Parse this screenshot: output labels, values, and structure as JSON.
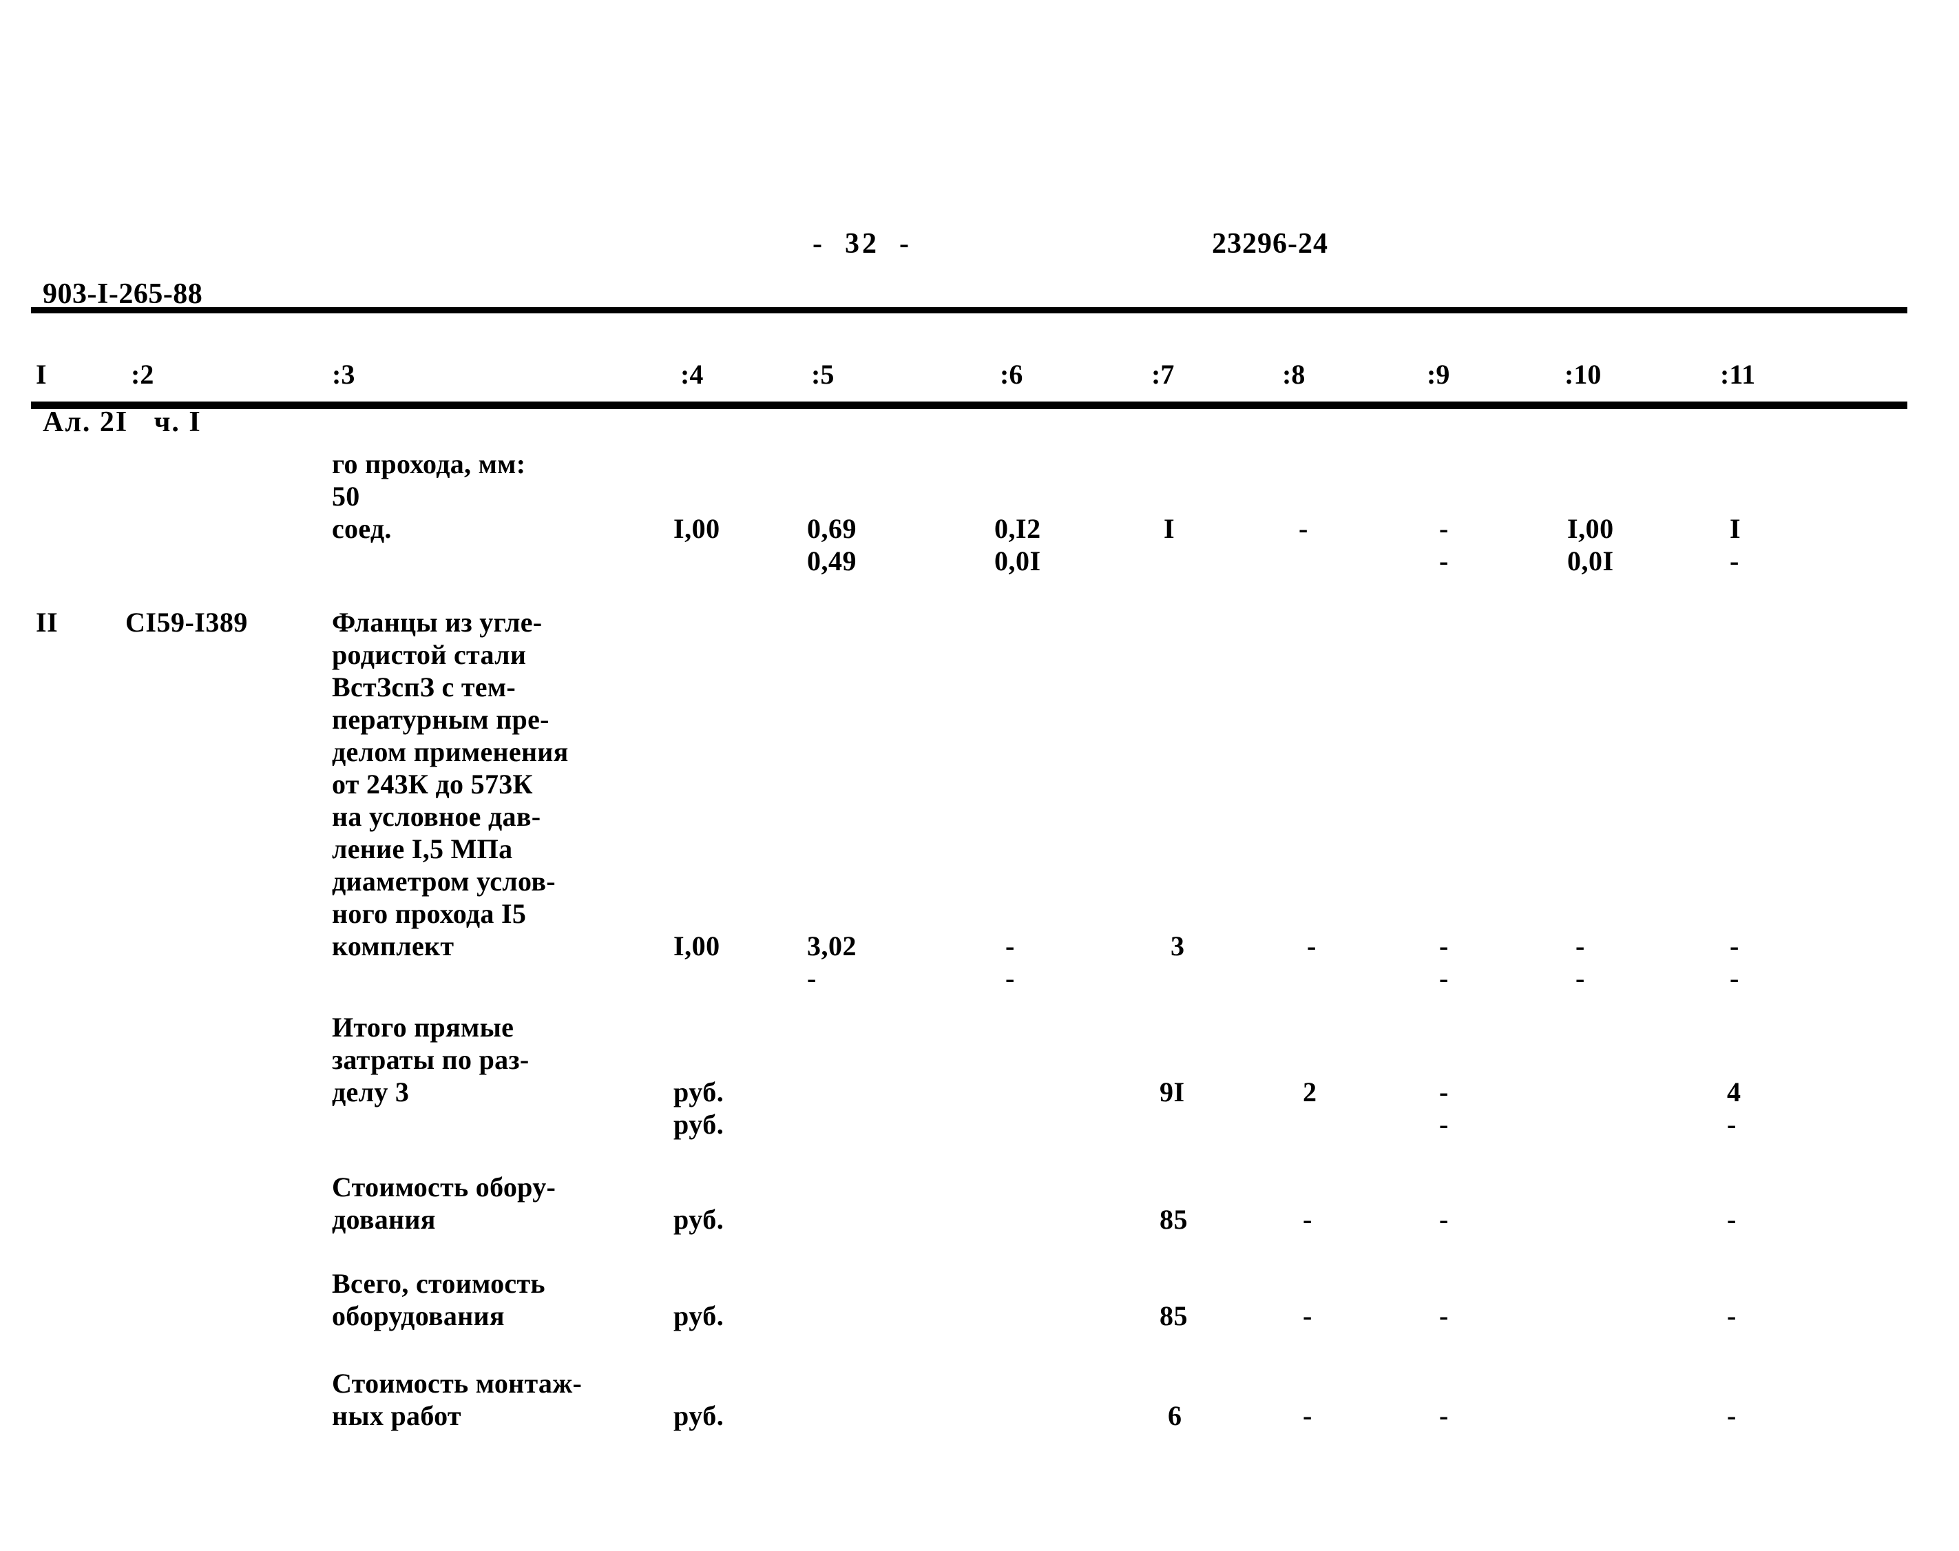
{
  "header": {
    "doc_number": "903-I-265-88",
    "album_part": "Ал. 2I   ч. I",
    "page_marker": "-  32  -",
    "sheet_code": "23296-24"
  },
  "table": {
    "column_headers": [
      "I",
      ":2",
      ":3",
      ":4",
      ":5",
      ":6",
      ":7",
      ":8",
      ":9",
      ":10",
      ":11"
    ],
    "rows": [
      {
        "name": "continued-item-row",
        "c1": "",
        "c2": "",
        "c3": "го прохода, мм:\n50\nсоед.",
        "c4": "I,00",
        "c5": "0,69\n0,49",
        "c6": "0,I2\n0,0I",
        "c7": "I",
        "c8": "-",
        "c9": "-\n-",
        "c10": "I,00\n0,0I",
        "c11": "I\n-"
      },
      {
        "name": "flange-item-row",
        "c1": "II",
        "c2": "CI59-I389",
        "c3": "Фланцы из угле-\nродистой стали\nВстЗспЗ с тем-\nпературным пре-\nделом применения\nот 243К до 573К\nна условное дав-\nление I,5 МПа\nдиаметром услов-\nного прохода I5\nкомплект",
        "c4": "I,00",
        "c5": "3,02\n-",
        "c6": "-\n-",
        "c7": "3",
        "c8": "-",
        "c9": "-\n-",
        "c10": "-\n-",
        "c11": "-\n-"
      },
      {
        "name": "total-direct-costs-row",
        "c1": "",
        "c2": "",
        "c3": "Итого прямые\nзатраты по раз-\nделу 3",
        "c4": "руб.\nруб.",
        "c5": "",
        "c6": "",
        "c7": "9I",
        "c8": "2",
        "c9": "-\n-",
        "c10": "",
        "c11": "4\n-"
      },
      {
        "name": "equipment-cost-row",
        "c1": "",
        "c2": "",
        "c3": "Стоимость обору-\nдования",
        "c4": "руб.",
        "c5": "",
        "c6": "",
        "c7": "85",
        "c8": "-",
        "c9": "-",
        "c10": "",
        "c11": "-"
      },
      {
        "name": "total-equipment-cost-row",
        "c1": "",
        "c2": "",
        "c3": "Всего, стоимость\nоборудования",
        "c4": "руб.",
        "c5": "",
        "c6": "",
        "c7": "85",
        "c8": "-",
        "c9": "-",
        "c10": "",
        "c11": "-"
      },
      {
        "name": "installation-works-cost-row",
        "c1": "",
        "c2": "",
        "c3": "Стоимость монтаж-\nных работ",
        "c4": "руб.",
        "c5": "",
        "c6": "",
        "c7": "6",
        "c8": "-",
        "c9": "-",
        "c10": "",
        "c11": "-"
      }
    ]
  }
}
